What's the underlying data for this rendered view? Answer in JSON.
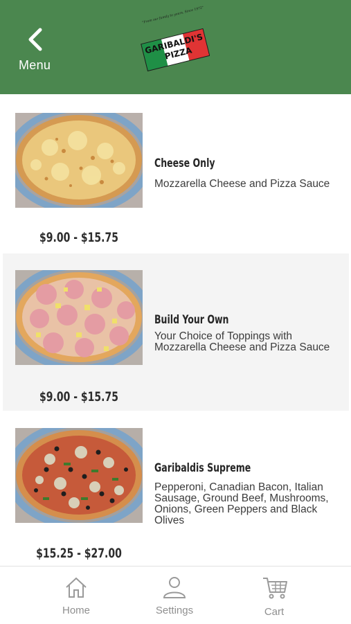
{
  "header": {
    "back_label": "Menu",
    "back_icon": "chevron-left-icon",
    "logo_text_line1": "GARIBALDI'S",
    "logo_text_line2": "PIZZA",
    "logo_tagline": "\"From our family to yours, Since 1972\"",
    "colors": {
      "header_bg": "#4b874f",
      "logo_green": "#1f8f46",
      "logo_red": "#e03434"
    }
  },
  "menu": {
    "items": [
      {
        "name": "Cheese Only",
        "description": "Mozzarella Cheese and Pizza Sauce",
        "price": "$9.00 - $15.75"
      },
      {
        "name": "Build Your Own",
        "description": "Your Choice of Toppings with Mozzarella Cheese and Pizza Sauce",
        "price": "$9.00 - $15.75"
      },
      {
        "name": "Garibaldis Supreme",
        "description": "Pepperoni, Canadian Bacon, Italian Sausage, Ground Beef, Mushrooms, Onions, Green Peppers and Black Olives",
        "price": "$15.25 - $27.00"
      }
    ]
  },
  "tabbar": {
    "tabs": [
      {
        "label": "Home",
        "icon": "home-icon"
      },
      {
        "label": "Settings",
        "icon": "user-icon"
      },
      {
        "label": "Cart",
        "icon": "cart-icon"
      }
    ]
  }
}
